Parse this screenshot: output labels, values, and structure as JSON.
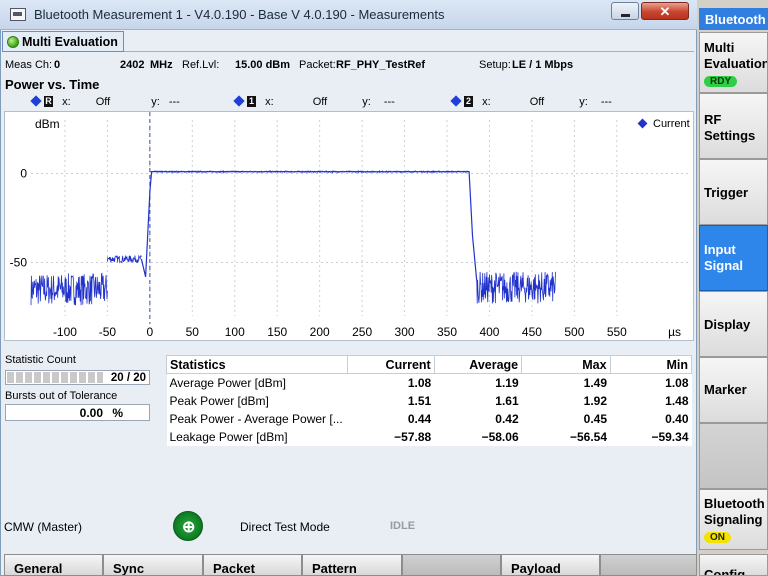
{
  "window": {
    "title": "Bluetooth Measurement 1 - V4.0.190 - Base V 4.0.190 - Measurements",
    "close_glyph": "✕"
  },
  "tab": {
    "label": "Multi Evaluation"
  },
  "info": {
    "meas_ch_label": "Meas Ch:",
    "meas_ch_value": "0",
    "freq_value": "2402",
    "freq_unit": "MHz",
    "ref_lvl_label": "Ref.Lvl:",
    "ref_lvl_value": "15.00 dBm",
    "packet_label": "Packet:",
    "packet_value": "RF_PHY_TestRef",
    "setup_label": "Setup:",
    "setup_value": "LE / 1 Mbps"
  },
  "chart_title": "Power vs. Time",
  "markers": [
    {
      "badge": "R",
      "x_label": "x:",
      "x_value": "Off",
      "y_label": "y:",
      "y_value": "---"
    },
    {
      "badge": "1",
      "x_label": "x:",
      "x_value": "Off",
      "y_label": "y:",
      "y_value": "---"
    },
    {
      "badge": "2",
      "x_label": "x:",
      "x_value": "Off",
      "y_label": "y:",
      "y_value": "---"
    }
  ],
  "chart_data": {
    "type": "line",
    "title": "",
    "ylabel": "dBm",
    "xlabel": "µs",
    "x_ticks": [
      -100,
      -50,
      0,
      50,
      100,
      150,
      200,
      250,
      300,
      350,
      400,
      450,
      500,
      550
    ],
    "y_ticks": [
      0,
      -50
    ],
    "xlim": [
      -140,
      635
    ],
    "ylim": [
      -80,
      30
    ],
    "grid": true,
    "legend": "top-right",
    "series": [
      {
        "name": "Current",
        "color": "#2233cc",
        "segments": [
          {
            "x_start": -140,
            "x_end": -50,
            "level": -65,
            "noise": 9
          },
          {
            "x_start": -50,
            "x_end": -10,
            "level": -48,
            "noise": 2
          },
          {
            "x_start": 0,
            "x_end": 376,
            "level": 1,
            "noise": 0.4
          },
          {
            "x_start": 385,
            "x_end": 478,
            "level": -64,
            "noise": 9
          }
        ],
        "points": [
          [
            -10,
            -48
          ],
          [
            -5,
            -58
          ],
          [
            0,
            -10
          ],
          [
            2,
            1
          ],
          [
            376,
            1
          ],
          [
            380,
            -35
          ],
          [
            385,
            -60
          ]
        ]
      }
    ]
  },
  "statistic_count": {
    "label": "Statistic Count",
    "value": "20 / 20",
    "fraction": 1.0
  },
  "bursts_tolerance": {
    "label": "Bursts out of Tolerance",
    "value": "0.00",
    "unit": "%"
  },
  "stats_table": {
    "headers": [
      "Statistics",
      "Current",
      "Average",
      "Max",
      "Min"
    ],
    "rows": [
      [
        "Average Power [dBm]",
        "1.08",
        "1.19",
        "1.49",
        "1.08"
      ],
      [
        "Peak Power [dBm]",
        "1.51",
        "1.61",
        "1.92",
        "1.48"
      ],
      [
        "Peak Power - Average Power [...",
        "0.44",
        "0.42",
        "0.45",
        "0.40"
      ],
      [
        "Leakage Power [dBm]",
        "−57.88",
        "−58.06",
        "−56.54",
        "−59.34"
      ]
    ]
  },
  "status": {
    "master": "CMW (Master)",
    "mode": "Direct Test Mode",
    "state": "IDLE",
    "antenna_glyph": "⊕"
  },
  "bottom_softkeys": [
    "General",
    "Sync",
    "Packet",
    "Pattern",
    "",
    "Payload",
    ""
  ],
  "right_panel": {
    "header": "Bluetooth",
    "keys": [
      {
        "label": "Multi Evaluation",
        "pill": "RDY"
      },
      {
        "label": "RF Settings"
      },
      {
        "label": "Trigger"
      },
      {
        "label": "Input Signal",
        "active": true
      },
      {
        "label": "Display"
      },
      {
        "label": "Marker"
      },
      {
        "label": ""
      },
      {
        "label": "Bluetooth Signaling",
        "pill": "ON"
      },
      {
        "label": "Config"
      }
    ]
  }
}
